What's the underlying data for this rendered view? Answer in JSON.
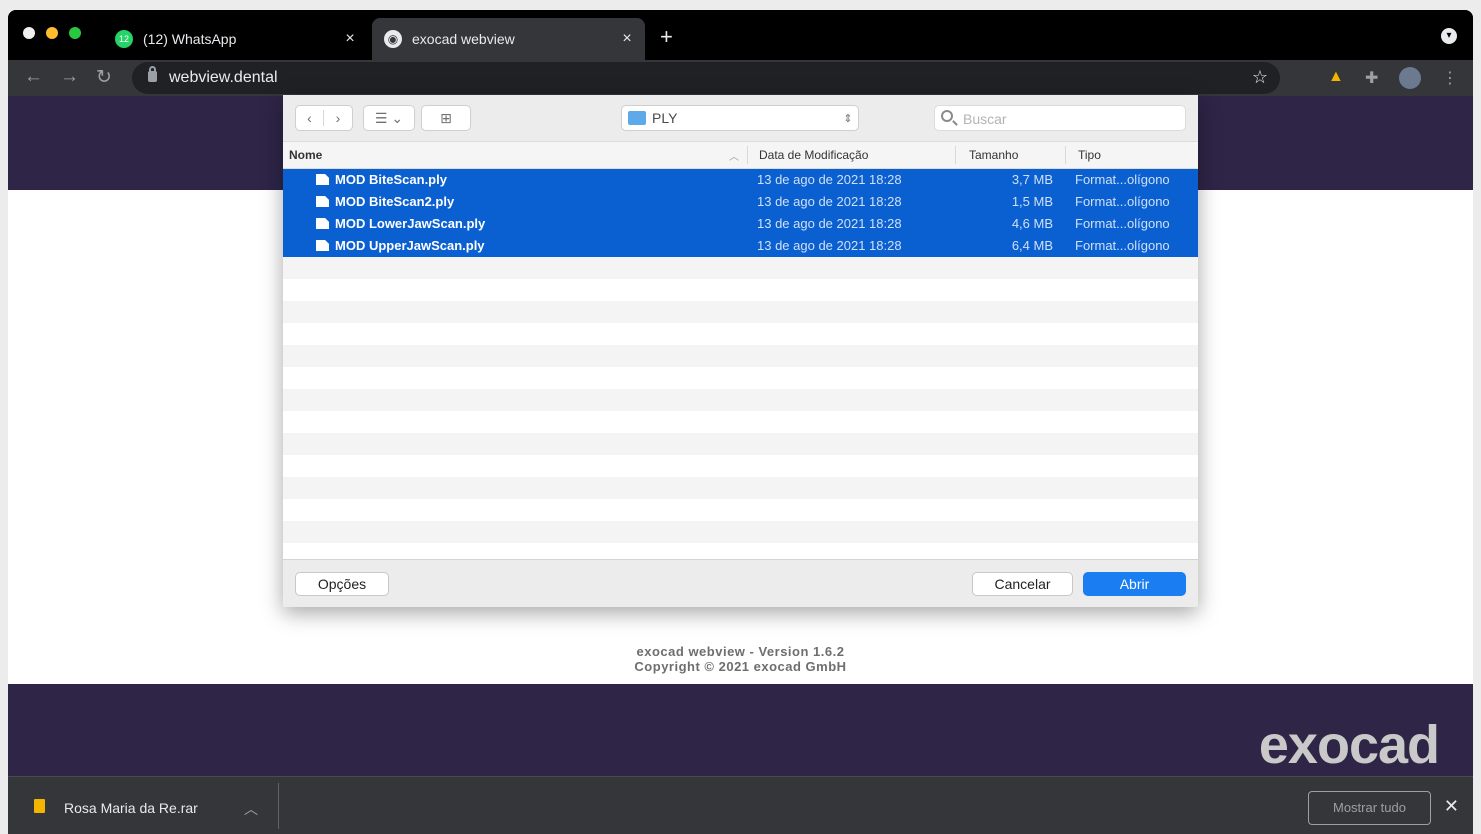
{
  "browser": {
    "tabs": [
      {
        "title": "(12) WhatsApp",
        "badge": "12",
        "close": "×",
        "active": false
      },
      {
        "title": "exocad webview",
        "close": "×",
        "active": true
      }
    ],
    "new_tab": "+",
    "url": "webview.dental",
    "icons": {
      "back": "back-arrow-icon",
      "forward": "forward-arrow-icon",
      "reload": "reload-icon",
      "lock": "lock-icon",
      "bookmark": "star-icon",
      "drive": "google-drive-icon",
      "extensions": "puzzle-icon",
      "menu": "kebab-menu-icon"
    }
  },
  "dialog": {
    "folder": "PLY",
    "search_placeholder": "Buscar",
    "columns": [
      "Nome",
      "Data de Modificação",
      "Tamanho",
      "Tipo"
    ],
    "files": [
      {
        "name": "MOD BiteScan.ply",
        "date": "13 de ago de 2021 18:28",
        "size": "3,7 MB",
        "type": "Format...olígono"
      },
      {
        "name": "MOD BiteScan2.ply",
        "date": "13 de ago de 2021 18:28",
        "size": "1,5 MB",
        "type": "Format...olígono"
      },
      {
        "name": "MOD LowerJawScan.ply",
        "date": "13 de ago de 2021 18:28",
        "size": "4,6 MB",
        "type": "Format...olígono"
      },
      {
        "name": "MOD UpperJawScan.ply",
        "date": "13 de ago de 2021 18:28",
        "size": "6,4 MB",
        "type": "Format...olígono"
      }
    ],
    "options_label": "Opções",
    "cancel_label": "Cancelar",
    "open_label": "Abrir"
  },
  "page": {
    "version": "exocad webview - Version 1.6.2",
    "copyright": "Copyright © 2021 exocad GmbH",
    "brand": "exocad"
  },
  "downloads": {
    "file_name": "Rosa Maria da Re.rar",
    "show_all": "Mostrar tudo",
    "close": "✕"
  },
  "colors": {
    "brand_band": "#2e2547",
    "selection": "#0a5fd1",
    "primary_button": "#1a7df2"
  }
}
